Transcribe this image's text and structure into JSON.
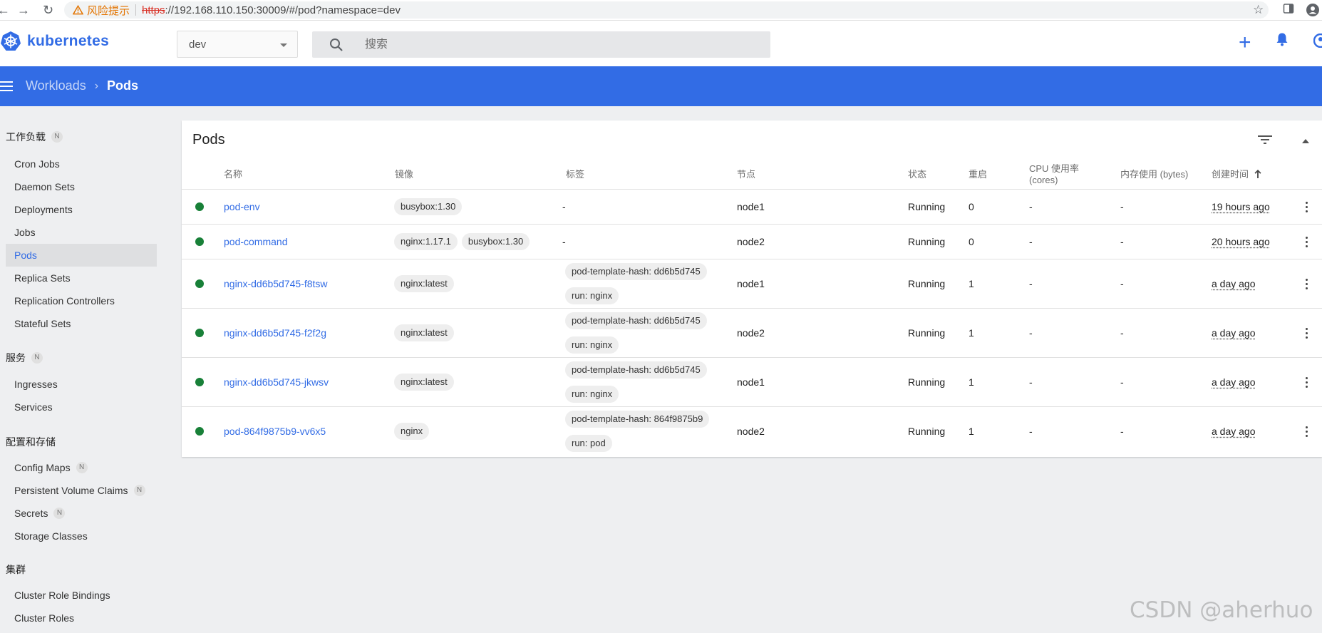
{
  "browser": {
    "warning": "风险提示",
    "url_protocol": "https",
    "url_rest": "://192.168.110.150:30009/#/pod?namespace=dev"
  },
  "header": {
    "logo_text": "kubernetes",
    "namespace": "dev",
    "search_placeholder": "搜索"
  },
  "toolbar": {
    "breadcrumb_parent": "Workloads",
    "breadcrumb_current": "Pods"
  },
  "sidebar": {
    "sections": [
      {
        "label": "工作负载",
        "badge": "N"
      },
      {
        "label": "服务",
        "badge": "N"
      },
      {
        "label": "配置和存储"
      },
      {
        "label": "集群"
      }
    ],
    "workloads": [
      "Cron Jobs",
      "Daemon Sets",
      "Deployments",
      "Jobs",
      "Pods",
      "Replica Sets",
      "Replication Controllers",
      "Stateful Sets"
    ],
    "service": [
      "Ingresses",
      "Services"
    ],
    "config": [
      {
        "label": "Config Maps",
        "badge": "N"
      },
      {
        "label": "Persistent Volume Claims",
        "badge": "N"
      },
      {
        "label": "Secrets",
        "badge": "N"
      },
      {
        "label": "Storage Classes"
      }
    ],
    "cluster": [
      "Cluster Role Bindings",
      "Cluster Roles"
    ],
    "active": "Pods"
  },
  "pods": {
    "title": "Pods",
    "columns": {
      "name": "名称",
      "image": "镜像",
      "labels": "标签",
      "node": "节点",
      "status": "状态",
      "restarts": "重启",
      "cpu_line1": "CPU 使用率",
      "cpu_line2": "(cores)",
      "memory": "内存使用 (bytes)",
      "created": "创建时间"
    },
    "rows": [
      {
        "name": "pod-env",
        "images": [
          "busybox:1.30"
        ],
        "labels": [
          "-"
        ],
        "node": "node1",
        "status": "Running",
        "restarts": "0",
        "cpu": "-",
        "memory": "-",
        "created": "19 hours ago"
      },
      {
        "name": "pod-command",
        "images": [
          "nginx:1.17.1",
          "busybox:1.30"
        ],
        "labels": [
          "-"
        ],
        "node": "node2",
        "status": "Running",
        "restarts": "0",
        "cpu": "-",
        "memory": "-",
        "created": "20 hours ago"
      },
      {
        "name": "nginx-dd6b5d745-f8tsw",
        "images": [
          "nginx:latest"
        ],
        "labels": [
          "pod-template-hash: dd6b5d745",
          "run: nginx"
        ],
        "node": "node1",
        "status": "Running",
        "restarts": "1",
        "cpu": "-",
        "memory": "-",
        "created": "a day ago"
      },
      {
        "name": "nginx-dd6b5d745-f2f2g",
        "images": [
          "nginx:latest"
        ],
        "labels": [
          "pod-template-hash: dd6b5d745",
          "run: nginx"
        ],
        "node": "node2",
        "status": "Running",
        "restarts": "1",
        "cpu": "-",
        "memory": "-",
        "created": "a day ago"
      },
      {
        "name": "nginx-dd6b5d745-jkwsv",
        "images": [
          "nginx:latest"
        ],
        "labels": [
          "pod-template-hash: dd6b5d745",
          "run: nginx"
        ],
        "node": "node1",
        "status": "Running",
        "restarts": "1",
        "cpu": "-",
        "memory": "-",
        "created": "a day ago"
      },
      {
        "name": "pod-864f9875b9-vv6x5",
        "images": [
          "nginx"
        ],
        "labels": [
          "pod-template-hash: 864f9875b9",
          "run: pod"
        ],
        "node": "node2",
        "status": "Running",
        "restarts": "1",
        "cpu": "-",
        "memory": "-",
        "created": "a day ago"
      }
    ]
  },
  "watermark": "CSDN @aherhuo",
  "colors": {
    "primary": "#326ce5",
    "running": "#188038",
    "background": "#eeeff1"
  }
}
